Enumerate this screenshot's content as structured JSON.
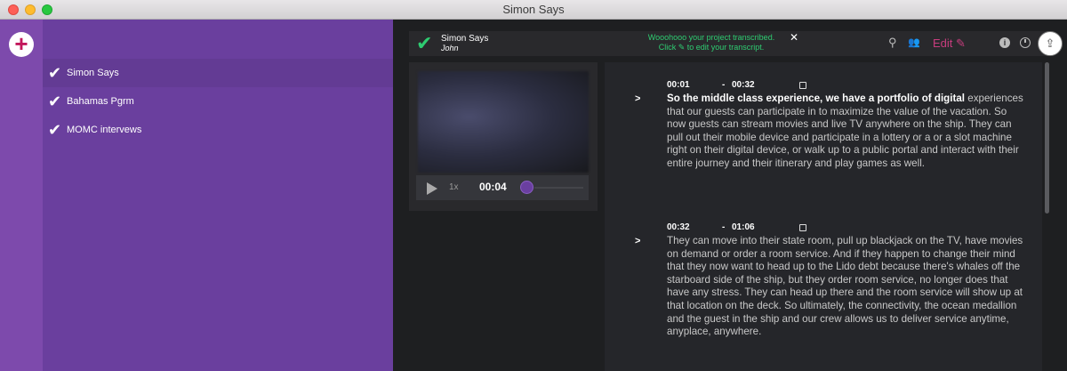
{
  "window": {
    "title": "Simon Says"
  },
  "sidebar": {
    "add_label": "+",
    "projects": [
      {
        "name": "Simon Says",
        "check": "✔"
      },
      {
        "name": "Bahamas Pgrm",
        "check": "✔"
      },
      {
        "name": "MOMC intervews",
        "check": "✔"
      }
    ]
  },
  "header": {
    "status_check": "✔",
    "project_title": "Simon Says",
    "user": "John",
    "notice_line1": "Wooohooo your project transcribed.",
    "notice_line2": "Click ✎ to edit your transcript.",
    "notice_close": "✕",
    "search_icon": "⚲",
    "users_icon": "👥",
    "edit_label": "Edit ✎",
    "info_label": "i",
    "share_icon": "⇪"
  },
  "player": {
    "speed": "1x",
    "current_time": "00:04",
    "progress": 0.02
  },
  "transcript": {
    "segments": [
      {
        "start": "00:01",
        "dash": "-",
        "end": "00:32",
        "arrow": ">",
        "highlight": "So the middle class experience, we have a portfolio of digital",
        "text": "experiences that our guests can participate in to maximize the value of the vacation. So now guests can stream movies and live TV anywhere on the ship. They can pull out their mobile device and participate in a lottery or a or a slot machine right on their digital device, or walk up to a public portal and interact with their entire journey and their itinerary and play games as well."
      },
      {
        "start": "00:32",
        "dash": "-",
        "end": "01:06",
        "arrow": ">",
        "text": "They can move into their state room, pull up blackjack on the TV, have movies on demand or order a room service. And if they happen to change their mind that they now want to head up to the Lido debt because there's whales off the starboard side of the ship, but they order room service, no longer does that have any stress. They can head up there and the room service will show up at that location on the deck. So ultimately, the connectivity, the ocean medallion and the guest in the ship and our crew allows us to deliver service anytime, anyplace, anywhere."
      }
    ]
  },
  "colors": {
    "accent_purple": "#6a3f9e",
    "success_green": "#2ecc71",
    "edit_pink": "#c73d7e"
  }
}
